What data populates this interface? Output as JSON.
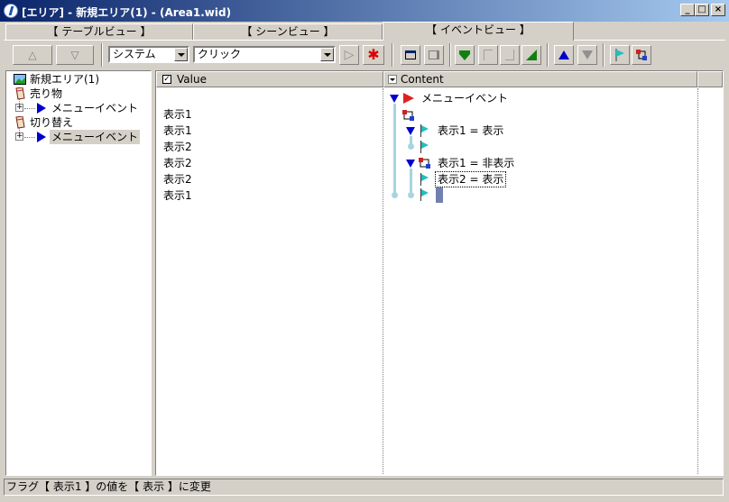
{
  "window": {
    "title": "[エリア] - 新規エリア(1) - (Area1.wid)",
    "minimize": "_",
    "maximize": "□",
    "close": "×"
  },
  "tabs": [
    {
      "label": "【 テーブルビュー 】",
      "active": false
    },
    {
      "label": "【 シーンビュー 】",
      "active": false
    },
    {
      "label": "【 イベントビュー 】",
      "active": true
    }
  ],
  "toolbar": {
    "up_label": "△",
    "down_label": "▽",
    "category_combo": "システム",
    "trigger_combo": "クリック",
    "play_label": "▷"
  },
  "tree": {
    "items": [
      {
        "label": "新規エリア(1)",
        "icon": "area-image-icon",
        "level": 0
      },
      {
        "label": "売り物",
        "icon": "card-icon",
        "level": 0
      },
      {
        "label": "メニューイベント",
        "icon": "blue-triangle-icon",
        "level": 1
      },
      {
        "label": "切り替え",
        "icon": "card-icon",
        "level": 0
      },
      {
        "label": "メニューイベント",
        "icon": "blue-triangle-icon",
        "level": 1,
        "selected": true
      }
    ]
  },
  "value_column": {
    "header": "Value",
    "rows": [
      "表示1",
      "表示1",
      "表示2",
      "表示2",
      "表示2",
      "表示1"
    ]
  },
  "content_column": {
    "header": "Content",
    "root_label": "メニューイベント",
    "lines": [
      {
        "label": "表示1 = 表示"
      },
      {
        "label": "表示1 = 非表示"
      },
      {
        "label": "表示2 = 表示"
      }
    ]
  },
  "status": {
    "text": "フラグ【 表示1 】の値を【 表示 】に変更"
  },
  "colors": {
    "title_start": "#0a246a",
    "title_end": "#a6caf0",
    "face": "#d4d0c8",
    "flag": "#20c0c0",
    "tree_line": "#a8d4e0",
    "accent_blue": "#0000cc"
  }
}
